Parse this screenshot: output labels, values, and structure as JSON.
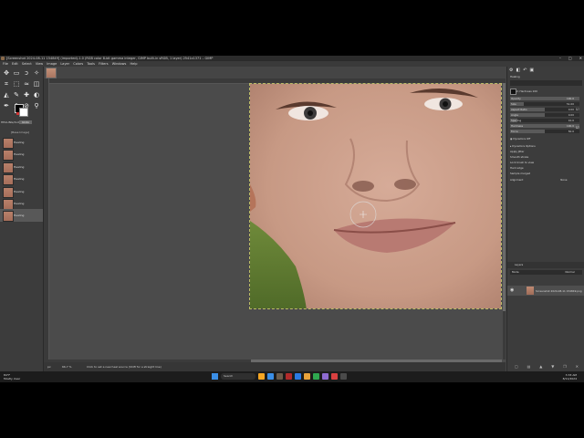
{
  "window": {
    "title": "[Screenshot 2024-08-11 154849] (imported)-1.0 (RGB color 8-bit gamma integer, GIMP built-in sRGB, 1 layer) 2541x1371 – GIMP",
    "controls": [
      "–",
      "□",
      "✕"
    ]
  },
  "menu": [
    "File",
    "Edit",
    "Select",
    "View",
    "Image",
    "Layer",
    "Colors",
    "Tools",
    "Filters",
    "Windows",
    "Help"
  ],
  "toolbox": {
    "tools": [
      "move-icon",
      "rect-select-icon",
      "lasso-icon",
      "fuzzy-select-icon",
      "crop-icon",
      "unified-transform-icon",
      "warp-icon",
      "cage-icon",
      "bucket-fill-icon",
      "paintbrush-icon",
      "heal-icon",
      "dodge-icon",
      "paths-icon",
      "text-icon",
      "color-picker-icon",
      "zoom-icon"
    ],
    "colors": {
      "foreground": "#000000",
      "background": "#ffffff"
    }
  },
  "left_dock": {
    "tab_label": "HEALING/CLONING",
    "tab_active": "Undo",
    "history_header": "[Base Image]",
    "history_items": [
      "Healing",
      "Healing",
      "Healing",
      "Healing",
      "Healing",
      "Healing",
      "Healing"
    ],
    "selected_index": 6
  },
  "status": {
    "unit": "px",
    "zoom": "66.7 %",
    "message": "Click to set a new heal source (Shift for a straight line)"
  },
  "right_dock": {
    "title": "Healing",
    "brush_name": "2. Hardness 100",
    "sliders": [
      {
        "label": "Opacity",
        "value": "100.0",
        "fraction": 1.0
      },
      {
        "label": "Size",
        "value": "51.00",
        "fraction": 0.2
      },
      {
        "label": "Aspect Ratio",
        "value": "0.00",
        "fraction": 0.5
      },
      {
        "label": "Angle",
        "value": "0.00",
        "fraction": 0.5
      },
      {
        "label": "Spacing",
        "value": "10.0",
        "fraction": 0.1
      },
      {
        "label": "Hardness",
        "value": "100.0",
        "fraction": 1.0
      },
      {
        "label": "Force",
        "value": "50.0",
        "fraction": 0.5
      }
    ],
    "dynamics_name": "Dynamics Off",
    "options": [
      "Dynamics Options",
      "Apply Jitter",
      "Smooth stroke",
      "Lock brush to view",
      "Hard edge",
      "Sample merged"
    ],
    "alignment": {
      "label": "Alignment",
      "value": "None"
    },
    "layers_tab": "Layers",
    "layers_mode": "Mode",
    "layers_mode_value": "Normal",
    "layer_name": "Screenshot 2024-08-11 154849.png"
  },
  "taskbar": {
    "weather_temp": "84°F",
    "weather_desc": "Mostly clear",
    "search_placeholder": "Search",
    "time": "3:33 AM",
    "date": "8/11/2024",
    "apps": [
      "#f5a623",
      "#3a8ee6",
      "#6b5b4a",
      "#b12a2a",
      "#2a7ae2",
      "#e8a23a",
      "#2fa84f",
      "#8e6bd1",
      "#d94040",
      "#4a4a4a"
    ]
  }
}
